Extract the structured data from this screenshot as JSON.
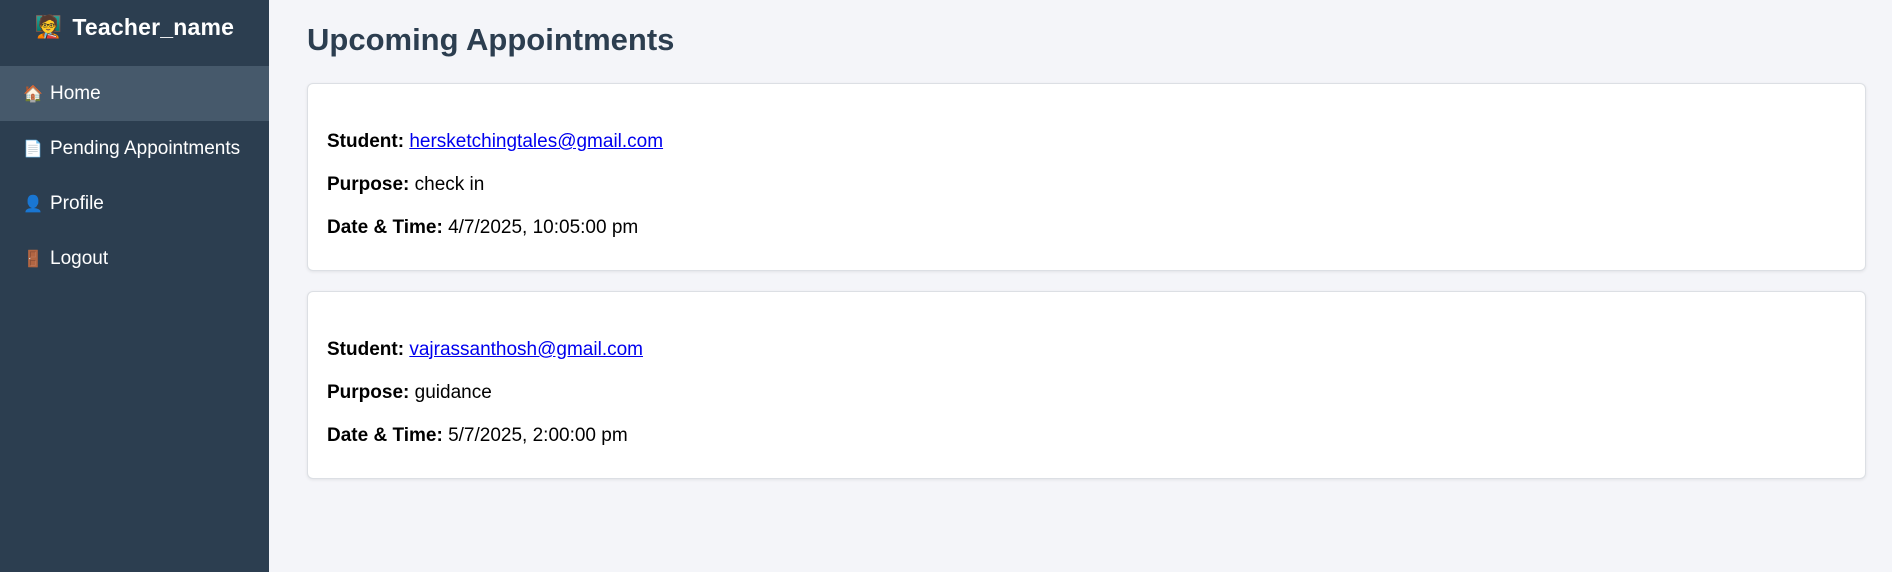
{
  "sidebar": {
    "brand": {
      "emoji": "🧑‍🏫",
      "name": "Teacher_name"
    },
    "items": [
      {
        "emoji": "🏠",
        "label": "Home",
        "active": true
      },
      {
        "emoji": "📄",
        "label": "Pending Appointments",
        "active": false
      },
      {
        "emoji": "👤",
        "label": "Profile",
        "active": false
      },
      {
        "emoji": "🚪",
        "label": "Logout",
        "active": false
      }
    ]
  },
  "main": {
    "title": "Upcoming Appointments",
    "labels": {
      "student": "Student:",
      "purpose": "Purpose:",
      "datetime": "Date & Time:"
    },
    "appointments": [
      {
        "student": "hersketchingtales@gmail.com",
        "purpose": "check in",
        "datetime": "4/7/2025, 10:05:00 pm"
      },
      {
        "student": "vajrassanthosh@gmail.com",
        "purpose": "guidance",
        "datetime": "5/7/2025, 2:00:00 pm"
      }
    ]
  },
  "colors": {
    "sidebar": "#2c3e50",
    "sidebar_active": "#46596b",
    "title": "#2c3e50",
    "link": "#0000ee",
    "background": "#f4f5f9"
  }
}
